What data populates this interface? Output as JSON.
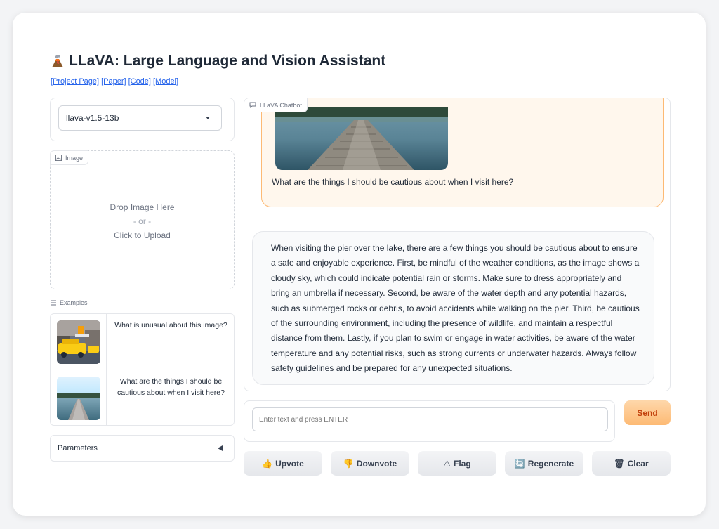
{
  "app": {
    "title": "LLaVA: Large Language and Vision Assistant",
    "links": [
      "[Project Page]",
      "[Paper]",
      "[Code]",
      "[Model]"
    ],
    "link_color": "#2563eb"
  },
  "model_selector": {
    "selected": "llava-v1.5-13b"
  },
  "image_upload": {
    "label": "Image",
    "drop_text": "Drop Image Here",
    "or_text": "- or -",
    "click_text": "Click to Upload"
  },
  "examples": {
    "label": "Examples",
    "items": [
      {
        "text": "What is unusual about this image?",
        "thumb": "taxi-ironing-photo"
      },
      {
        "text": "What are the things I should be cautious about when I visit here?",
        "thumb": "lake-pier-photo"
      }
    ]
  },
  "parameters": {
    "label": "Parameters"
  },
  "chatbot": {
    "label": "LLaVA Chatbot",
    "messages": [
      {
        "role": "user",
        "image": "lake-pier-photo",
        "text": "What are the things I should be cautious about when I visit here?"
      },
      {
        "role": "assistant",
        "text": "When visiting the pier over the lake, there are a few things you should be cautious about to ensure a safe and enjoyable experience. First, be mindful of the weather conditions, as the image shows a cloudy sky, which could indicate potential rain or storms. Make sure to dress appropriately and bring an umbrella if necessary. Second, be aware of the water depth and any potential hazards, such as submerged rocks or debris, to avoid accidents while walking on the pier. Third, be cautious of the surrounding environment, including the presence of wildlife, and maintain a respectful distance from them. Lastly, if you plan to swim or engage in water activities, be aware of the water temperature and any potential risks, such as strong currents or underwater hazards. Always follow safety guidelines and be prepared for any unexpected situations."
      }
    ]
  },
  "input": {
    "placeholder": "Enter text and press ENTER",
    "value": ""
  },
  "send_button": {
    "label": "Send",
    "color": "#fdba74"
  },
  "actions": [
    {
      "icon": "thumbs-up-icon",
      "glyph": "👍",
      "label": "Upvote"
    },
    {
      "icon": "thumbs-down-icon",
      "glyph": "👎",
      "label": "Downvote"
    },
    {
      "icon": "warning-icon",
      "glyph": "⚠",
      "label": "Flag"
    },
    {
      "icon": "regenerate-icon",
      "glyph": "🔄",
      "label": "Regenerate"
    },
    {
      "icon": "trash-icon",
      "glyph": "🗑",
      "label": "Clear"
    }
  ]
}
